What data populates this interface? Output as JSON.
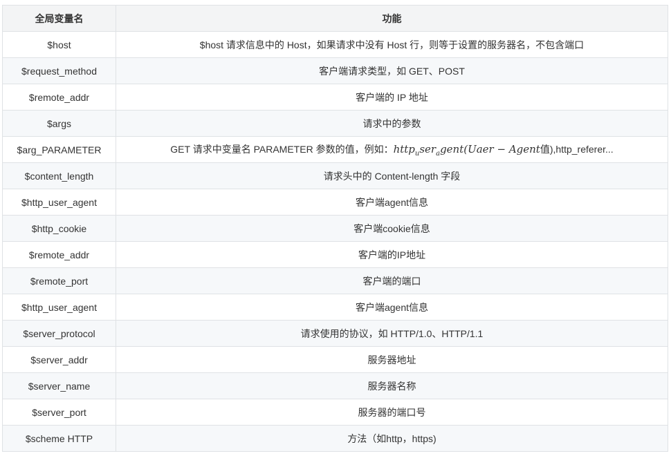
{
  "table": {
    "headers": [
      "全局变量名",
      "功能"
    ],
    "rows": [
      {
        "var": "$host",
        "desc": "$host 请求信息中的 Host，如果请求中没有 Host 行，则等于设置的服务器名，不包含端口"
      },
      {
        "var": "$request_method",
        "desc": "客户端请求类型，如 GET、POST"
      },
      {
        "var": "$remote_addr",
        "desc": "客户端的 IP 地址"
      },
      {
        "var": "$args",
        "desc": "请求中的参数"
      },
      {
        "var": "$arg_PARAMETER",
        "desc_prefix": "GET 请求中变量名 PARAMETER 参数的值，例如：",
        "math_a": "http",
        "math_a_sub": "u",
        "math_b": "ser",
        "math_b_sub": "a",
        "math_c": "gent(Uaer − Agent",
        "math_end": "值)",
        "desc_suffix": ",http_referer..."
      },
      {
        "var": "$content_length",
        "desc": "请求头中的 Content-length 字段"
      },
      {
        "var": "$http_user_agent",
        "desc": "客户端agent信息"
      },
      {
        "var": "$http_cookie",
        "desc": "客户端cookie信息"
      },
      {
        "var": "$remote_addr",
        "desc": "客户端的IP地址"
      },
      {
        "var": "$remote_port",
        "desc": "客户端的端口"
      },
      {
        "var": "$http_user_agent",
        "desc": "客户端agent信息"
      },
      {
        "var": "$server_protocol",
        "desc": "请求使用的协议，如 HTTP/1.0、HTTP/1.1"
      },
      {
        "var": "$server_addr",
        "desc": "服务器地址"
      },
      {
        "var": "$server_name",
        "desc": "服务器名称"
      },
      {
        "var": "$server_port",
        "desc": "服务器的端口号"
      },
      {
        "var": "$scheme HTTP",
        "desc": "方法（如http，https)"
      }
    ]
  }
}
